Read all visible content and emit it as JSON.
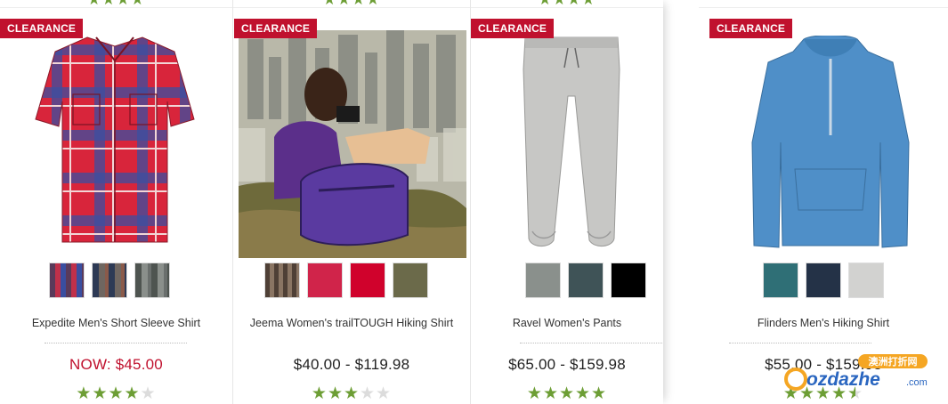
{
  "colors": {
    "badge": "#c0112e",
    "sale_price": "#c0112e",
    "star_filled": "#6d9e35",
    "star_empty": "#dcdcdc"
  },
  "products": [
    {
      "badge": "CLEARANCE",
      "name": "Expedite Men's Short Sleeve Shirt",
      "price": "NOW: $45.00",
      "rating": 4,
      "top_rating": 4,
      "image_icon": "plaid-shirt-icon",
      "swatch_colors": [
        "#8b3a4a",
        "#5c5a63",
        "#6f7372"
      ]
    },
    {
      "badge": "CLEARANCE",
      "name": "Jeema Women's trailTOUGH Hiking Shirt",
      "price": "$40.00 - $119.98",
      "rating": 3,
      "top_rating": 4,
      "image_icon": "hiker-photo-icon",
      "swatch_colors": [
        "#6c5a49",
        "#d0244a",
        "#d0022c",
        "#6b6a4a"
      ]
    },
    {
      "badge": "CLEARANCE",
      "name": "Ravel Women's Pants",
      "price": "$65.00 - $159.98",
      "rating": 5,
      "top_rating": 4,
      "image_icon": "pants-icon",
      "swatch_colors": [
        "#8a908c",
        "#3f5357",
        "#000000"
      ]
    },
    {
      "badge": "CLEARANCE",
      "name": "Flinders Men's Hiking Shirt",
      "price": "$55.00 - $159.98",
      "rating": 4.5,
      "top_rating": 4,
      "image_icon": "hooded-shirt-icon",
      "swatch_colors": [
        "#2f6f76",
        "#243247",
        "#d2d2d0"
      ]
    }
  ],
  "watermark": {
    "brand": "ozdazhe",
    "suffix": ".com",
    "tagline": "澳洲打折网"
  }
}
